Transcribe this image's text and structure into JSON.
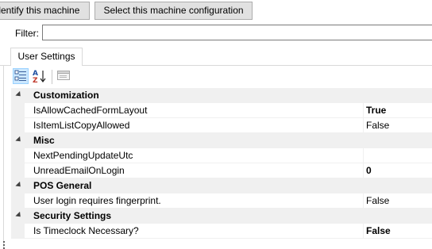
{
  "buttons": {
    "identify": "Identify this machine",
    "select_config": "Select this machine configuration"
  },
  "filter": {
    "label": "Filter:",
    "value": "",
    "placeholder": ""
  },
  "tabs": [
    {
      "label": "User Settings",
      "active": true
    }
  ],
  "toolbar": {
    "categorized_icon": "categorized-view-icon",
    "alphabetical_icon": "sort-alphabetical-icon",
    "property_pages_icon": "property-pages-icon"
  },
  "grid": {
    "categories": [
      {
        "name": "Customization",
        "properties": [
          {
            "name": "IsAllowCachedFormLayout",
            "value": "True",
            "bold": true
          },
          {
            "name": "IsItemListCopyAllowed",
            "value": "False",
            "bold": false
          }
        ]
      },
      {
        "name": "Misc",
        "properties": [
          {
            "name": "NextPendingUpdateUtc",
            "value": "",
            "bold": false
          },
          {
            "name": "UnreadEmailOnLogin",
            "value": "0",
            "bold": true
          }
        ]
      },
      {
        "name": "POS General",
        "properties": [
          {
            "name": "User login requires fingerprint.",
            "value": "False",
            "bold": false
          }
        ]
      },
      {
        "name": "Security Settings",
        "properties": [
          {
            "name": "Is Timeclock Necessary?",
            "value": "False",
            "bold": true
          }
        ]
      }
    ]
  },
  "colors": {
    "button_bg": "#e1e1e1",
    "category_bg": "#f0f0f0",
    "selected_tool_bg": "#cce8ff"
  }
}
